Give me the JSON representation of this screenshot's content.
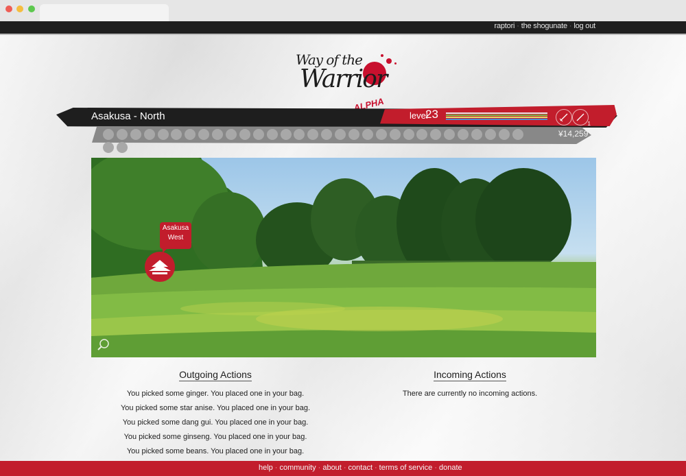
{
  "top_nav": {
    "links": [
      "raptori",
      "the shogunate",
      "log out"
    ]
  },
  "logo": {
    "line1": "Way of the",
    "line2": "Warrior",
    "badge": "ALPHA"
  },
  "status": {
    "location": "Asakusa - North",
    "level_label": "level",
    "level_value": "23",
    "money": "¥14,259",
    "skill_count": "1",
    "xp_filled": 0,
    "xp_total": 33,
    "bars": {
      "health": 1.0,
      "stamina": 1.0,
      "energy": 1.0
    }
  },
  "scene": {
    "destination": {
      "line1": "Asakusa",
      "line2": "West"
    },
    "zoom_icon": "magnifier-icon"
  },
  "outgoing": {
    "title": "Outgoing Actions",
    "items": [
      "You picked some ginger. You placed one in your bag.",
      "You picked some star anise. You placed one in your bag.",
      "You picked some dang gui. You placed one in your bag.",
      "You picked some ginseng. You placed one in your bag.",
      "You picked some beans. You placed one in your bag."
    ]
  },
  "incoming": {
    "title": "Incoming Actions",
    "empty_message": "There are currently no incoming actions."
  },
  "footer": {
    "links": [
      "help",
      "community",
      "about",
      "contact",
      "terms of service",
      "donate"
    ]
  },
  "colors": {
    "accent": "#c21d2c",
    "dark": "#1e1e1e"
  }
}
